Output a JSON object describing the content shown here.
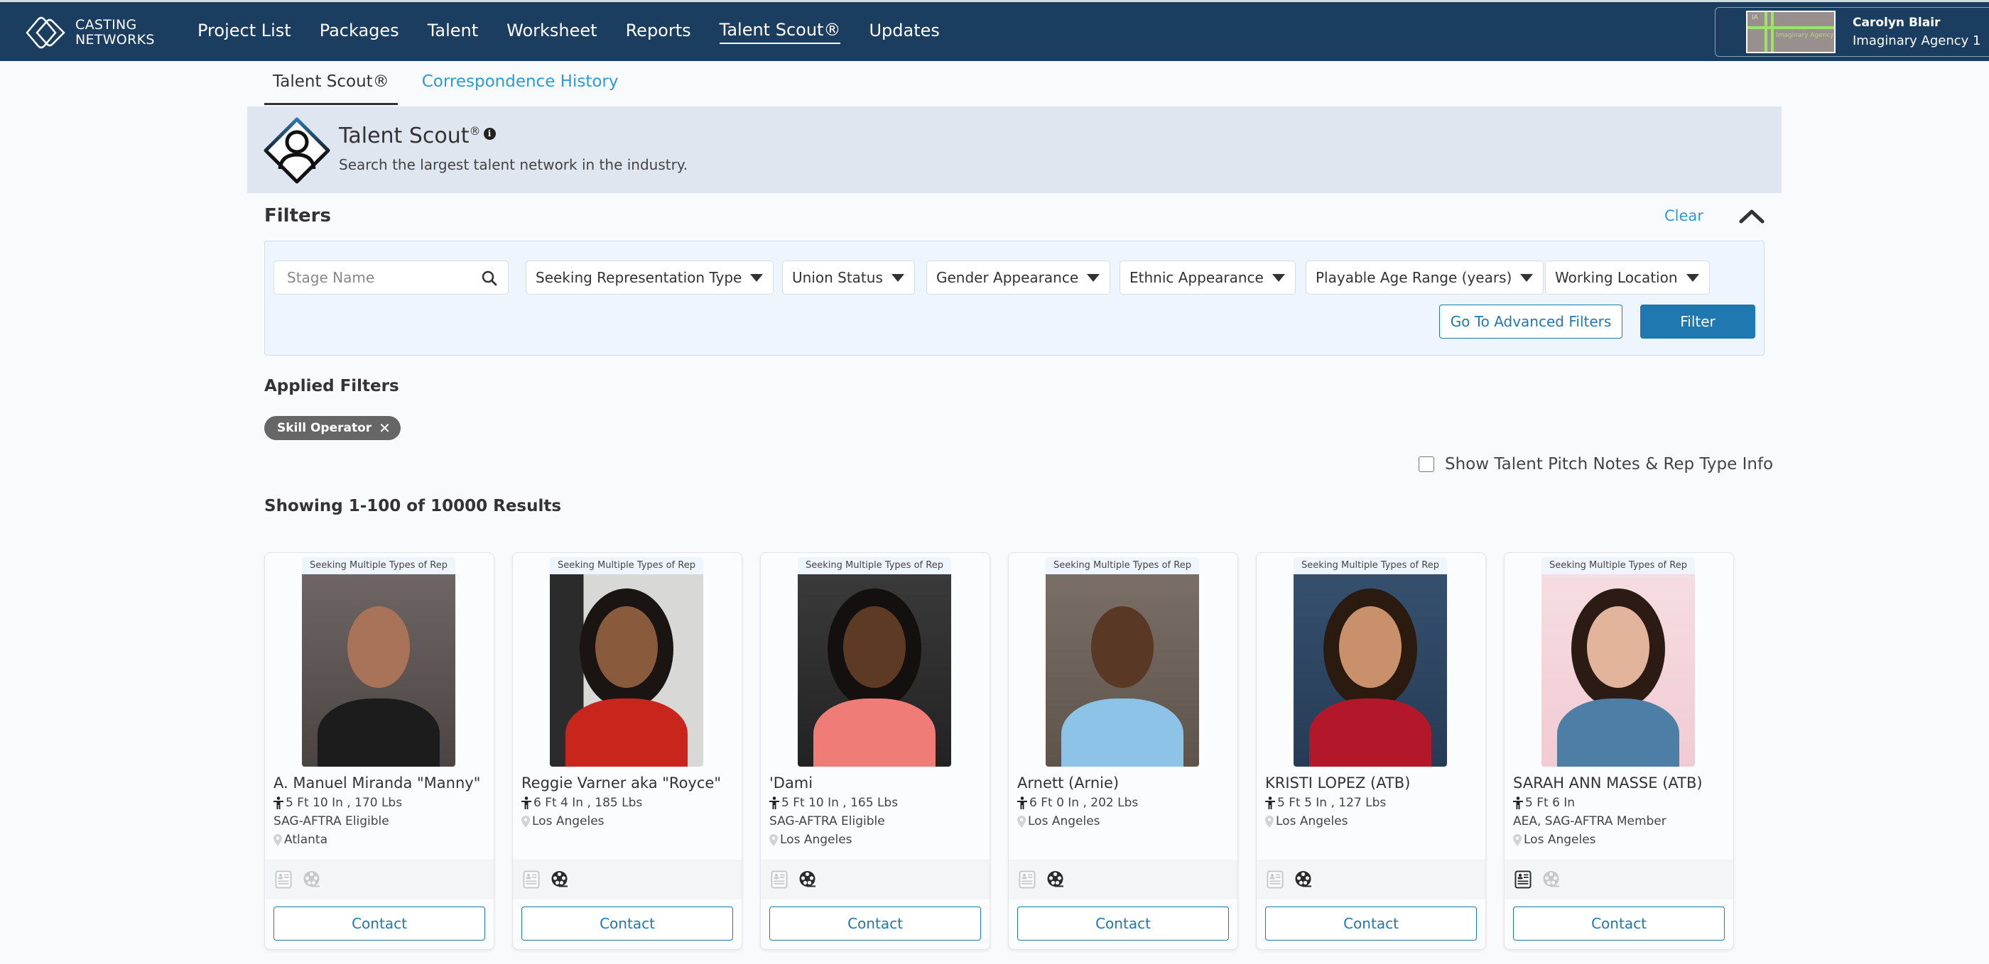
{
  "brand": {
    "line1": "CASTING",
    "line2": "NETWORKS",
    "color": "#1b3d5f"
  },
  "nav": {
    "items": [
      {
        "label": "Project List",
        "active": false
      },
      {
        "label": "Packages",
        "active": false
      },
      {
        "label": "Talent",
        "active": false
      },
      {
        "label": "Worksheet",
        "active": false
      },
      {
        "label": "Reports",
        "active": false
      },
      {
        "label": "Talent Scout®",
        "active": true
      },
      {
        "label": "Updates",
        "active": false
      }
    ]
  },
  "account": {
    "name": "Carolyn Blair",
    "agency": "Imaginary Agency 1",
    "logo_text_top": "IA",
    "logo_text": "Imaginary Agency"
  },
  "subtabs": [
    {
      "label": "Talent Scout®",
      "active": true
    },
    {
      "label": "Correspondence History",
      "active": false
    }
  ],
  "hero": {
    "title": "Talent Scout",
    "title_mark": "®",
    "info_icon": "i",
    "subtitle": "Search the largest talent network in the industry."
  },
  "filters": {
    "title": "Filters",
    "clear_label": "Clear",
    "stage_name_placeholder": "Stage Name",
    "stage_name_value": "",
    "dropdowns": [
      "Seeking Representation Type",
      "Union Status",
      "Gender Appearance",
      "Ethnic Appearance",
      "Playable Age Range (years)",
      "Working Location"
    ],
    "advanced_label": "Go To Advanced Filters",
    "filter_label": "Filter"
  },
  "applied": {
    "title": "Applied Filters",
    "chips": [
      {
        "label": "Skill Operator"
      }
    ]
  },
  "pitch_toggle": {
    "label": "Show Talent Pitch Notes & Rep Type Info",
    "checked": false
  },
  "results": {
    "summary": "Showing 1-100 of 10000 Results"
  },
  "talent": [
    {
      "rep": "Seeking Multiple Types of Rep",
      "name": "A. Manuel Miranda \"Manny\"",
      "stats": "5 Ft 10 In , 170 Lbs",
      "union": "SAG-AFTRA Eligible",
      "location": "Atlanta",
      "has_resume": false,
      "has_reel": false,
      "contact": "Contact"
    },
    {
      "rep": "Seeking Multiple Types of Rep",
      "name": "Reggie Varner aka \"Royce\"",
      "stats": "6 Ft 4 In , 185 Lbs",
      "union": "",
      "location": "Los Angeles",
      "has_resume": false,
      "has_reel": true,
      "contact": "Contact"
    },
    {
      "rep": "Seeking Multiple Types of Rep",
      "name": "'Dami",
      "stats": "5 Ft 10 In , 165 Lbs",
      "union": "SAG-AFTRA Eligible",
      "location": "Los Angeles",
      "has_resume": false,
      "has_reel": true,
      "contact": "Contact"
    },
    {
      "rep": "Seeking Multiple Types of Rep",
      "name": "Arnett (Arnie)",
      "stats": "6 Ft 0 In , 202 Lbs",
      "union": "",
      "location": "Los Angeles",
      "has_resume": false,
      "has_reel": true,
      "contact": "Contact"
    },
    {
      "rep": "Seeking Multiple Types of Rep",
      "name": "KRISTI LOPEZ (ATB)",
      "stats": "5 Ft 5 In , 127 Lbs",
      "union": "",
      "location": "Los Angeles",
      "has_resume": false,
      "has_reel": true,
      "contact": "Contact"
    },
    {
      "rep": "Seeking Multiple Types of Rep",
      "name": "SARAH ANN MASSE (ATB)",
      "stats": "5 Ft 6 In",
      "union": "AEA, SAG-AFTRA Member",
      "location": "Los Angeles",
      "has_resume": true,
      "has_reel": false,
      "contact": "Contact"
    }
  ],
  "colors": {
    "accent": "#1f78b0",
    "link": "#2e9ad6",
    "nav_bg": "#1b3d5f",
    "icon_active": "#2b2b2b",
    "icon_inactive": "#c8c8c8"
  }
}
